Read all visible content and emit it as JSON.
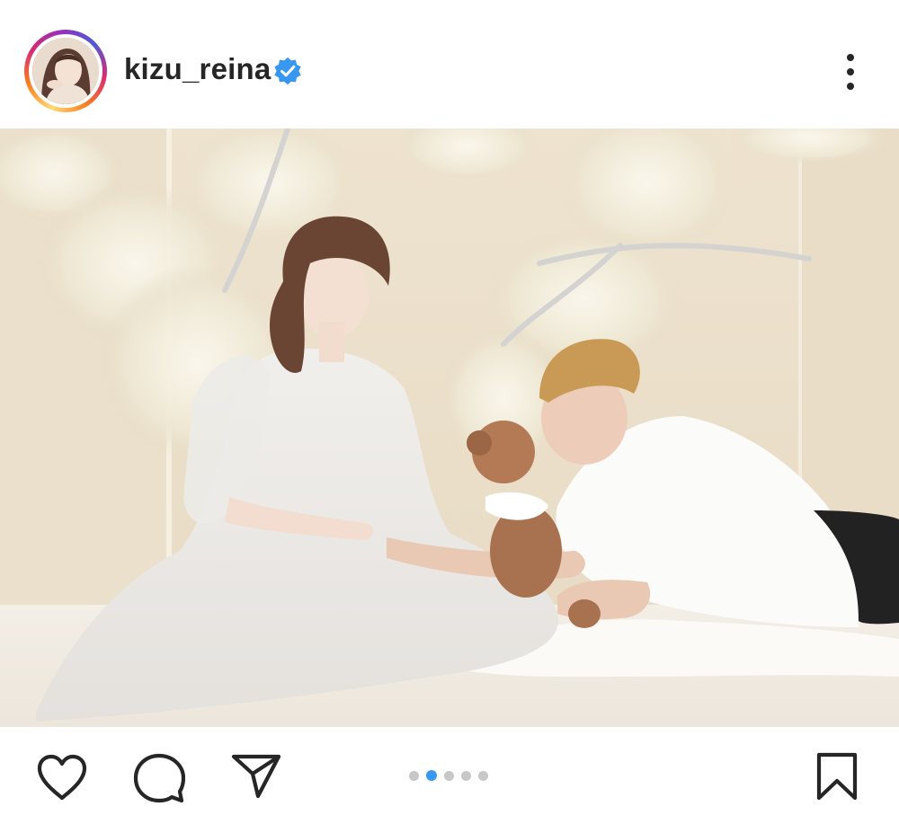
{
  "post": {
    "username": "kizu_reina",
    "verified": true,
    "icons": {
      "avatar": "profile-avatar",
      "verified": "verified-badge-icon",
      "more": "more-options-icon",
      "like": "heart-icon",
      "comment": "comment-icon",
      "share": "send-icon",
      "save": "bookmark-icon"
    },
    "carousel": {
      "total_slides": 5,
      "active_slide": 2
    },
    "colors": {
      "verified_badge": "#3897f0",
      "active_dot": "#3897f0",
      "inactive_dot": "#c7c7c7",
      "icon_stroke": "#262626"
    }
  }
}
